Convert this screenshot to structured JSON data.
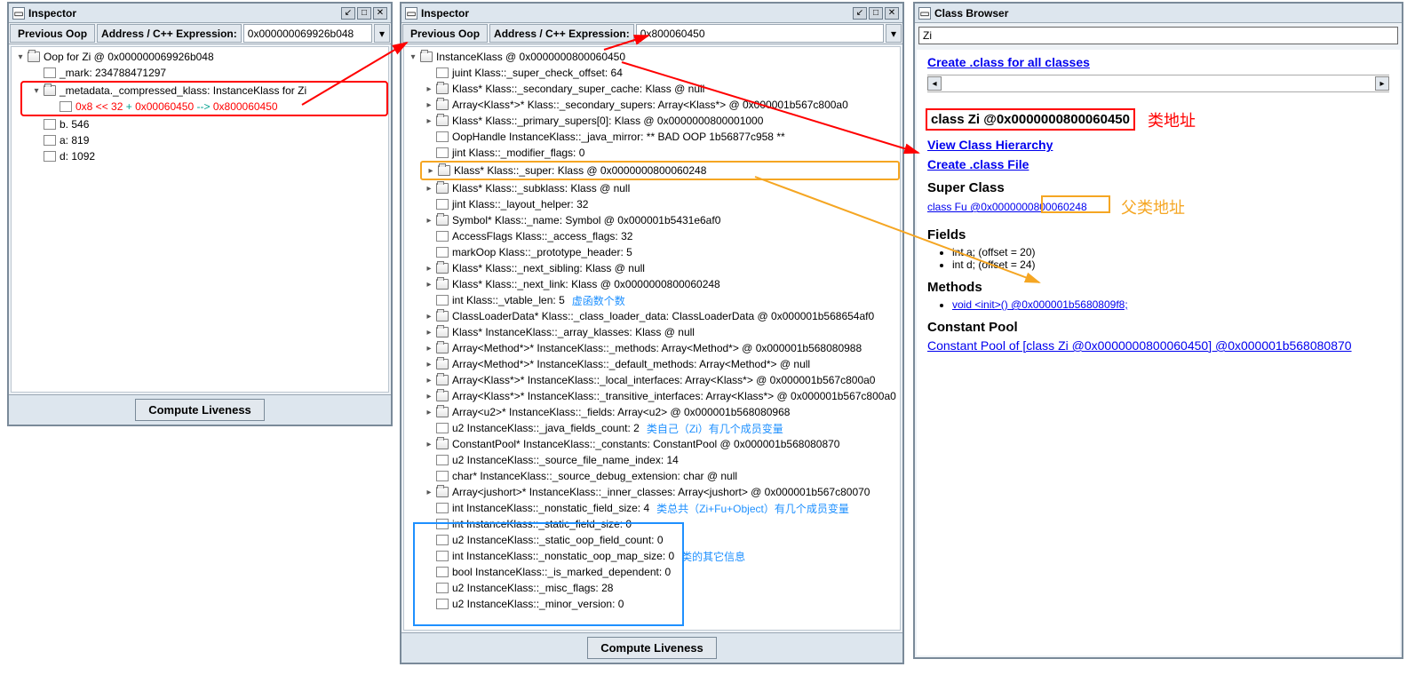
{
  "window1": {
    "title": "Inspector",
    "prev_btn": "Previous Oop",
    "addr_label": "Address / C++ Expression:",
    "addr_value": "0x000000069926b048",
    "tree": {
      "root": "Oop for Zi @ 0x000000069926b048",
      "mark": "_mark: 234788471297",
      "meta": "_metadata._compressed_klass: InstanceKlass for Zi",
      "formula_a": "0x8 << 32",
      "formula_plus": " + ",
      "formula_b": "0x00060450",
      "formula_arrow": " --> ",
      "formula_c": "0x800060450",
      "b": "b. 546",
      "a": "a: 819",
      "d": "d: 1092"
    },
    "compute": "Compute Liveness"
  },
  "window2": {
    "title": "Inspector",
    "prev_btn": "Previous Oop",
    "addr_label": "Address / C++ Expression:",
    "addr_value": "0x800060450",
    "compute": "Compute Liveness",
    "items": [
      {
        "icon": "folder",
        "label": "InstanceKlass @ 0x0000000800060450"
      },
      {
        "icon": "leaf",
        "ind": 1,
        "label": "juint Klass::_super_check_offset: 64"
      },
      {
        "icon": "folder",
        "ind": 1,
        "label": "Klass* Klass::_secondary_super_cache: Klass @ null",
        "tog": "▸"
      },
      {
        "icon": "folder",
        "ind": 1,
        "label": "Array<Klass*>* Klass::_secondary_supers: Array<Klass*> @ 0x000001b567c800a0",
        "tog": "▸"
      },
      {
        "icon": "folder",
        "ind": 1,
        "label": "Klass* Klass::_primary_supers[0]: Klass @ 0x0000000800001000",
        "tog": "▸"
      },
      {
        "icon": "leaf",
        "ind": 1,
        "label": "OopHandle InstanceKlass::_java_mirror: ** BAD OOP 1b56877c958 **"
      },
      {
        "icon": "leaf",
        "ind": 1,
        "label": "jint Klass::_modifier_flags: 0"
      },
      {
        "icon": "folder",
        "ind": 1,
        "label": "Klass* Klass::_super: Klass @ 0x0000000800060248",
        "tog": "▸",
        "box": "orange"
      },
      {
        "icon": "folder",
        "ind": 1,
        "label": "Klass* Klass::_subklass: Klass @ null",
        "tog": "▸"
      },
      {
        "icon": "leaf",
        "ind": 1,
        "label": "jint Klass::_layout_helper: 32"
      },
      {
        "icon": "folder",
        "ind": 1,
        "label": "Symbol* Klass::_name: Symbol @ 0x000001b5431e6af0",
        "tog": "▸"
      },
      {
        "icon": "leaf",
        "ind": 1,
        "label": "AccessFlags Klass::_access_flags: 32"
      },
      {
        "icon": "leaf",
        "ind": 1,
        "label": "markOop Klass::_prototype_header: 5"
      },
      {
        "icon": "folder",
        "ind": 1,
        "label": "Klass* Klass::_next_sibling: Klass @ null",
        "tog": "▸"
      },
      {
        "icon": "folder",
        "ind": 1,
        "label": "Klass* Klass::_next_link: Klass @ 0x0000000800060248",
        "tog": "▸"
      },
      {
        "icon": "leaf",
        "ind": 1,
        "label": "int Klass::_vtable_len: 5",
        "annot": "虚函数个数"
      },
      {
        "icon": "folder",
        "ind": 1,
        "label": "ClassLoaderData* Klass::_class_loader_data: ClassLoaderData @ 0x000001b568654af0",
        "tog": "▸"
      },
      {
        "icon": "folder",
        "ind": 1,
        "label": "Klass* InstanceKlass::_array_klasses: Klass @ null",
        "tog": "▸"
      },
      {
        "icon": "folder",
        "ind": 1,
        "label": "Array<Method*>* InstanceKlass::_methods: Array<Method*> @ 0x000001b568080988",
        "tog": "▸"
      },
      {
        "icon": "folder",
        "ind": 1,
        "label": "Array<Method*>* InstanceKlass::_default_methods: Array<Method*> @ null",
        "tog": "▸"
      },
      {
        "icon": "folder",
        "ind": 1,
        "label": "Array<Klass*>* InstanceKlass::_local_interfaces: Array<Klass*> @ 0x000001b567c800a0",
        "tog": "▸"
      },
      {
        "icon": "folder",
        "ind": 1,
        "label": "Array<Klass*>* InstanceKlass::_transitive_interfaces: Array<Klass*> @ 0x000001b567c800a0",
        "tog": "▸"
      },
      {
        "icon": "folder",
        "ind": 1,
        "label": "Array<u2>* InstanceKlass::_fields: Array<u2> @ 0x000001b568080968",
        "tog": "▸"
      },
      {
        "icon": "leaf",
        "ind": 1,
        "label": "u2 InstanceKlass::_java_fields_count: 2",
        "annot": "类自己（Zi）有几个成员变量"
      },
      {
        "icon": "folder",
        "ind": 1,
        "label": "ConstantPool* InstanceKlass::_constants: ConstantPool @ 0x000001b568080870",
        "tog": "▸"
      },
      {
        "icon": "leaf",
        "ind": 1,
        "label": "u2 InstanceKlass::_source_file_name_index: 14"
      },
      {
        "icon": "leaf",
        "ind": 1,
        "label": "char* InstanceKlass::_source_debug_extension: char @ null"
      },
      {
        "icon": "folder",
        "ind": 1,
        "label": "Array<jushort>* InstanceKlass::_inner_classes: Array<jushort> @ 0x000001b567c80070",
        "tog": "▸"
      },
      {
        "icon": "leaf",
        "ind": 1,
        "label": "int InstanceKlass::_nonstatic_field_size: 4",
        "annot": "类总共（Zi+Fu+Object）有几个成员变量"
      },
      {
        "icon": "leaf",
        "ind": 1,
        "label": "int InstanceKlass::_static_field_size: 0",
        "box": "blue-start"
      },
      {
        "icon": "leaf",
        "ind": 1,
        "label": "u2 InstanceKlass::_static_oop_field_count: 0"
      },
      {
        "icon": "leaf",
        "ind": 1,
        "label": "int InstanceKlass::_nonstatic_oop_map_size: 0",
        "annot": "类的其它信息"
      },
      {
        "icon": "leaf",
        "ind": 1,
        "label": "bool InstanceKlass::_is_marked_dependent: 0"
      },
      {
        "icon": "leaf",
        "ind": 1,
        "label": "u2 InstanceKlass::_misc_flags: 28"
      },
      {
        "icon": "leaf",
        "ind": 1,
        "label": "u2 InstanceKlass::_minor_version: 0"
      }
    ]
  },
  "window3": {
    "title": "Class Browser",
    "search": "Zi",
    "link_create_all": "Create .class for all classes",
    "class_line": "class Zi @0x0000000800060450",
    "class_annot": "类地址",
    "link_hierarchy": "View Class Hierarchy",
    "link_create": "Create .class File",
    "super_heading": "Super Class",
    "super_link": "class Fu @0x0000000800060248",
    "super_annot": "父类地址",
    "fields_heading": "Fields",
    "field1": "int a; (offset = 20)",
    "field2": "int d; (offset = 24)",
    "methods_heading": "Methods",
    "method1": "void <init>() @0x000001b5680809f8;",
    "cp_heading": "Constant Pool",
    "cp_link": "Constant Pool of [class Zi @0x0000000800060450] @0x000001b568080870"
  }
}
